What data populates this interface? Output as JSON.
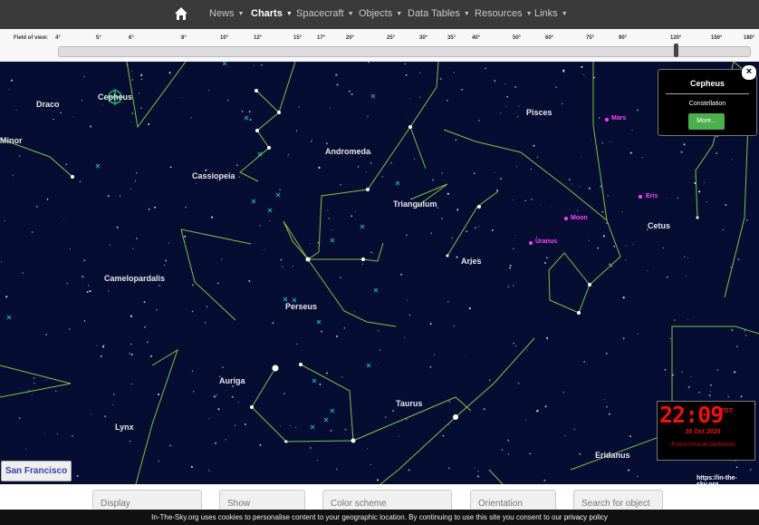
{
  "nav": {
    "home_icon": "home-icon",
    "items": [
      {
        "label": "News",
        "active": false
      },
      {
        "label": "Charts",
        "active": true
      },
      {
        "label": "Spacecraft",
        "active": false
      },
      {
        "label": "Objects",
        "active": false
      },
      {
        "label": "Data Tables",
        "active": false
      },
      {
        "label": "Resources",
        "active": false
      },
      {
        "label": "Links",
        "active": false
      }
    ]
  },
  "fov": {
    "label": "Field of view:",
    "ticks": [
      "4°",
      "5°",
      "6°",
      "8°",
      "10°",
      "12°",
      "15°",
      "17°",
      "20°",
      "25°",
      "30°",
      "35°",
      "40°",
      "50°",
      "60°",
      "75°",
      "90°",
      "120°",
      "150°",
      "180°"
    ],
    "current": "120°"
  },
  "sky": {
    "background": "#060d33",
    "line_color": "#7fc241",
    "constellations": [
      "Draco",
      "Minor",
      "Cepheus",
      "Cassiopeia",
      "Andromeda",
      "Pisces",
      "Triangulum",
      "Cetus",
      "Camelopardalis",
      "Aries",
      "Perseus",
      "Auriga",
      "Taurus",
      "Lynx",
      "Eridanus"
    ],
    "planets": [
      "Mars",
      "Eris",
      "Moon",
      "Uranus"
    ],
    "planet_color": "#ff44ff",
    "selected": "Cepheus"
  },
  "infobox": {
    "title": "Cepheus",
    "type": "Constellation",
    "button": "More..."
  },
  "clock": {
    "time": "22:09",
    "tz": "PDT",
    "date": "30 Oct 2020",
    "status": "Astronomical darkness",
    "color": "#ee1111"
  },
  "location": "San Francisco",
  "credit": "https://in-the-sky.org",
  "controls": [
    "Display",
    "Show",
    "Color scheme",
    "Orientation",
    "Search for object"
  ],
  "cookie": {
    "text": "In-The-Sky.org uses cookies to personalise content to your geographic location. By continuing to use this site you consent to our",
    "link": "privacy policy"
  }
}
